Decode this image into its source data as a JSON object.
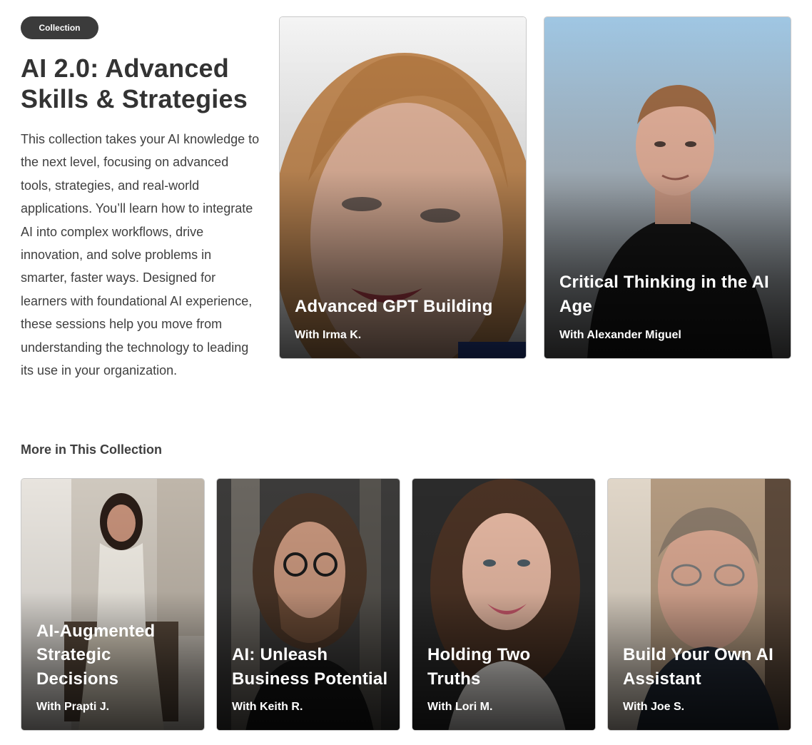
{
  "collection": {
    "badge": "Collection",
    "title": "AI 2.0: Advanced Skills & Strategies",
    "description": "This collection takes your AI knowledge to the next level, focusing on advanced tools, strategies, and real-world applications. You’ll learn how to integrate AI into complex workflows, drive innovation, and solve problems in smarter, faster ways. Designed for learners with foundational AI experience, these sessions help you move from understanding the technology to leading its use in your organization."
  },
  "featured": [
    {
      "title": "Advanced GPT Building",
      "instructor": "With Irma K."
    },
    {
      "title": "Critical Thinking in the AI Age",
      "instructor": "With Alexander Miguel"
    }
  ],
  "more": {
    "heading": "More in This Collection",
    "items": [
      {
        "title": "AI-Augmented Strategic Decisions",
        "instructor": "With Prapti J."
      },
      {
        "title": "AI: Unleash Business Potential",
        "instructor": "With Keith R."
      },
      {
        "title": "Holding Two Truths",
        "instructor": "With Lori M."
      },
      {
        "title": "Build Your Own AI Assistant",
        "instructor": "With Joe S."
      }
    ]
  },
  "colors": {
    "badge_bg": "#3b3b3b",
    "text_dark": "#333333",
    "card_text": "#ffffff"
  }
}
